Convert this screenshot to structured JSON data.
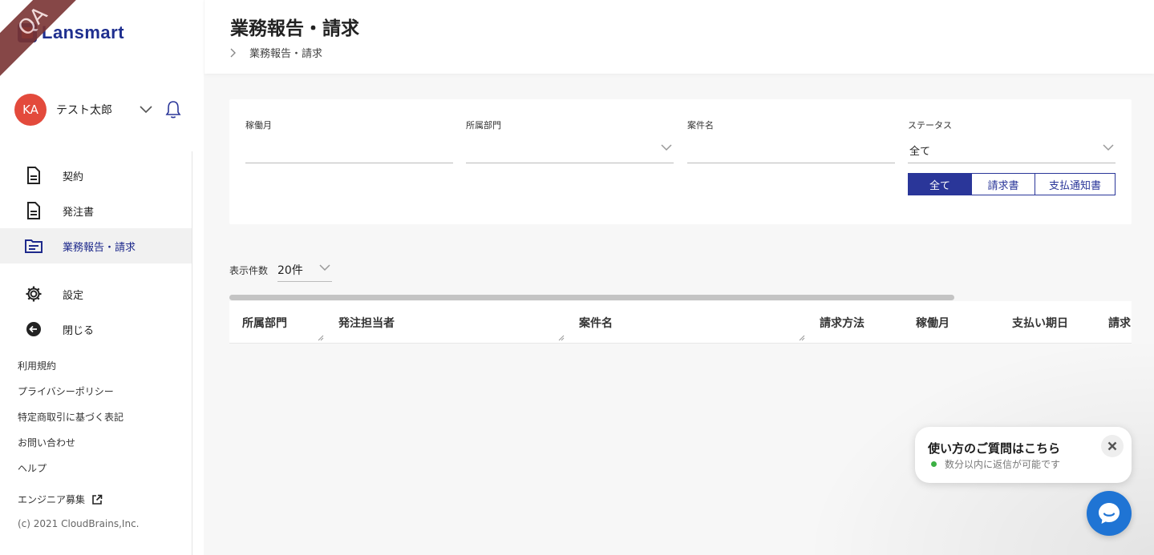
{
  "env_badge": "QA",
  "brand": {
    "name": "Lansmart",
    "color": "#1f2f8f",
    "accent": "#e84c3d"
  },
  "user": {
    "initials": "KA",
    "name": "テスト太郎",
    "avatar_color": "#e34a3c"
  },
  "nav": {
    "items": [
      {
        "label": "契約",
        "icon": "document-icon"
      },
      {
        "label": "発注書",
        "icon": "document-icon"
      },
      {
        "label": "業務報告・請求",
        "icon": "folder-icon",
        "active": true
      }
    ],
    "settings": {
      "label": "設定",
      "icon": "gear-icon"
    },
    "close": {
      "label": "閉じる",
      "icon": "back-arrow-icon"
    }
  },
  "footer": {
    "links": [
      "利用規約",
      "プライバシーポリシー",
      "特定商取引に基づく表記",
      "お問い合わせ",
      "ヘルプ"
    ],
    "careers": "エンジニア募集",
    "copyright": "(c) 2021 CloudBrains,Inc."
  },
  "header": {
    "title": "業務報告・請求",
    "breadcrumb": "業務報告・請求"
  },
  "filters": {
    "month": {
      "label": "稼働月",
      "value": ""
    },
    "department": {
      "label": "所属部門",
      "value": ""
    },
    "project": {
      "label": "案件名",
      "value": ""
    },
    "status": {
      "label": "ステータス",
      "value": "全て"
    },
    "doc_type": {
      "options": [
        "全て",
        "請求書",
        "支払通知書"
      ],
      "selected": "全て",
      "color": "#2a3699"
    }
  },
  "per_page": {
    "label": "表示件数",
    "value": "20件"
  },
  "table": {
    "columns": [
      "所属部門",
      "発注担当者",
      "案件名",
      "請求方法",
      "稼働月",
      "支払い期日",
      "請求"
    ]
  },
  "chat": {
    "title": "使い方のご質問はこちら",
    "status": "数分以内に返信が可能です",
    "launcher_color": "#1f74d4"
  }
}
